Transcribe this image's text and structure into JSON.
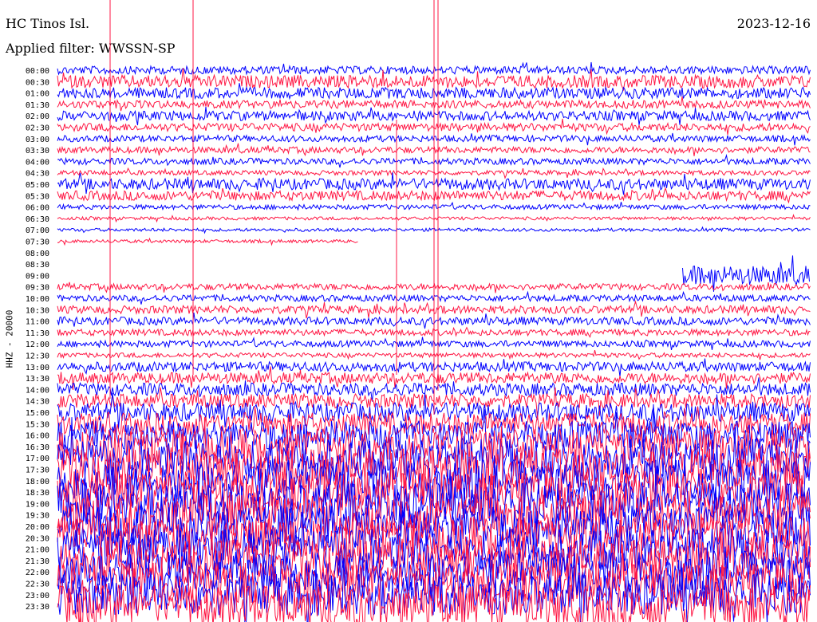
{
  "header": {
    "station": "HC Tinos Isl.",
    "date": "2023-12-16",
    "filter": "Applied filter: WWSSN-SP"
  },
  "chart_data": {
    "type": "line",
    "ylabel": "HHZ - 20000",
    "row_labels": [
      "00:00",
      "00:30",
      "01:00",
      "01:30",
      "02:00",
      "02:30",
      "03:00",
      "03:30",
      "04:00",
      "04:30",
      "05:00",
      "05:30",
      "06:00",
      "06:30",
      "07:00",
      "07:30",
      "08:00",
      "08:30",
      "09:00",
      "09:30",
      "10:00",
      "10:30",
      "11:00",
      "11:30",
      "12:00",
      "12:30",
      "13:00",
      "13:30",
      "14:00",
      "14:30",
      "15:00",
      "15:30",
      "16:00",
      "16:30",
      "17:00",
      "17:30",
      "18:00",
      "18:30",
      "19:00",
      "19:30",
      "20:00",
      "20:30",
      "21:00",
      "21:30",
      "22:00",
      "22:30",
      "23:00",
      "23:30"
    ],
    "trace_colors": [
      "#0000ff",
      "#ff1744"
    ],
    "noise_level": [
      5,
      8,
      7,
      5,
      6,
      5,
      4,
      4,
      4,
      3,
      7,
      6,
      3,
      2,
      2,
      2,
      0,
      0,
      12,
      4,
      4,
      5,
      5,
      4,
      4,
      3,
      6,
      7,
      8,
      9,
      12,
      14,
      18,
      22,
      24,
      26,
      26,
      26,
      26,
      26,
      26,
      26,
      26,
      26,
      26,
      26,
      26,
      26
    ],
    "gaps": [
      {
        "row": 15,
        "from": 0.4
      },
      {
        "row": 16,
        "from": 0
      },
      {
        "row": 17,
        "from": 0
      },
      {
        "row": 18,
        "from": 0,
        "to": 0.83
      }
    ]
  }
}
